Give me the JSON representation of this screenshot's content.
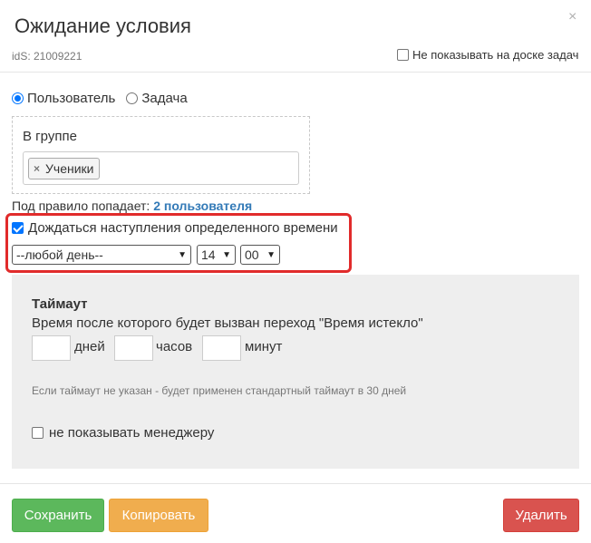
{
  "dialog": {
    "title": "Ожидание условия",
    "close_glyph": "×",
    "ids_label": "idS: 21009221",
    "hide_on_board_label": "Не показывать на доске задач"
  },
  "target": {
    "options": [
      "Пользователь",
      "Задача"
    ],
    "selected": "Пользователь"
  },
  "group": {
    "label": "В группе",
    "tags": [
      "Ученики"
    ],
    "tag_remove_glyph": "×"
  },
  "rule": {
    "prefix": "Под правило попадает:",
    "link": "2 пользователя"
  },
  "wait_time": {
    "checkbox_label": "Дождаться наступления определенного времени",
    "checked": true,
    "day_value": "--любой день--",
    "hour_value": "14",
    "minute_value": "00"
  },
  "timeout": {
    "heading": "Таймаут",
    "description": "Время после которого будет вызван переход \"Время истекло\"",
    "days_label": "дней",
    "hours_label": "часов",
    "minutes_label": "минут",
    "days_value": "",
    "hours_value": "",
    "minutes_value": "",
    "note": "Если таймаут не указан - будет применен стандартный таймаут в 30 дней",
    "hide_manager_label": "не показывать менеджеру",
    "hide_manager_checked": false
  },
  "buttons": {
    "save": "Сохранить",
    "copy": "Копировать",
    "delete": "Удалить"
  },
  "colors": {
    "save": "#5cb85c",
    "copy": "#f0ad4e",
    "delete": "#d9534f",
    "highlight": "#e12b2b",
    "link": "#337ab7"
  }
}
